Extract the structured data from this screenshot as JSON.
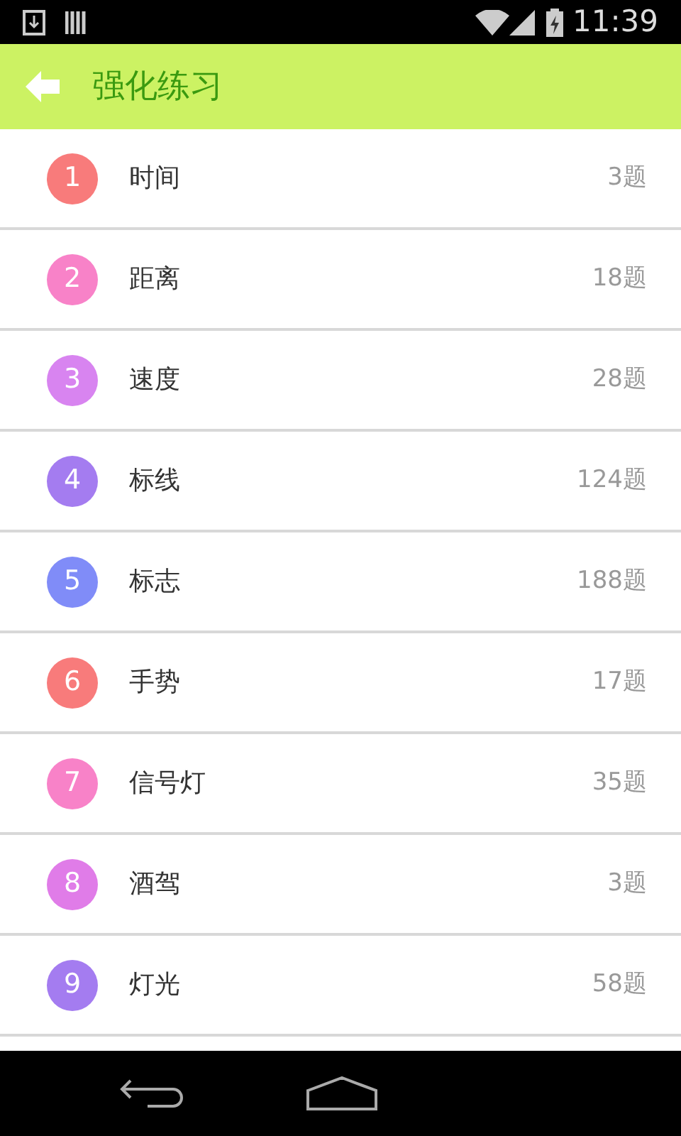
{
  "status_bar": {
    "time": "11:39"
  },
  "header": {
    "title": "强化练习"
  },
  "items": [
    {
      "number": "1",
      "label": "时间",
      "count": "3题",
      "color": "#f87b7b"
    },
    {
      "number": "2",
      "label": "距离",
      "count": "18题",
      "color": "#f882c8"
    },
    {
      "number": "3",
      "label": "速度",
      "count": "28题",
      "color": "#d884f0"
    },
    {
      "number": "4",
      "label": "标线",
      "count": "124题",
      "color": "#a47cf0"
    },
    {
      "number": "5",
      "label": "标志",
      "count": "188题",
      "color": "#808cf8"
    },
    {
      "number": "6",
      "label": "手势",
      "count": "17题",
      "color": "#f87b7b"
    },
    {
      "number": "7",
      "label": "信号灯",
      "count": "35题",
      "color": "#f882c8"
    },
    {
      "number": "8",
      "label": "酒驾",
      "count": "3题",
      "color": "#e07ce8"
    },
    {
      "number": "9",
      "label": "灯光",
      "count": "58题",
      "color": "#a47cf0"
    }
  ]
}
